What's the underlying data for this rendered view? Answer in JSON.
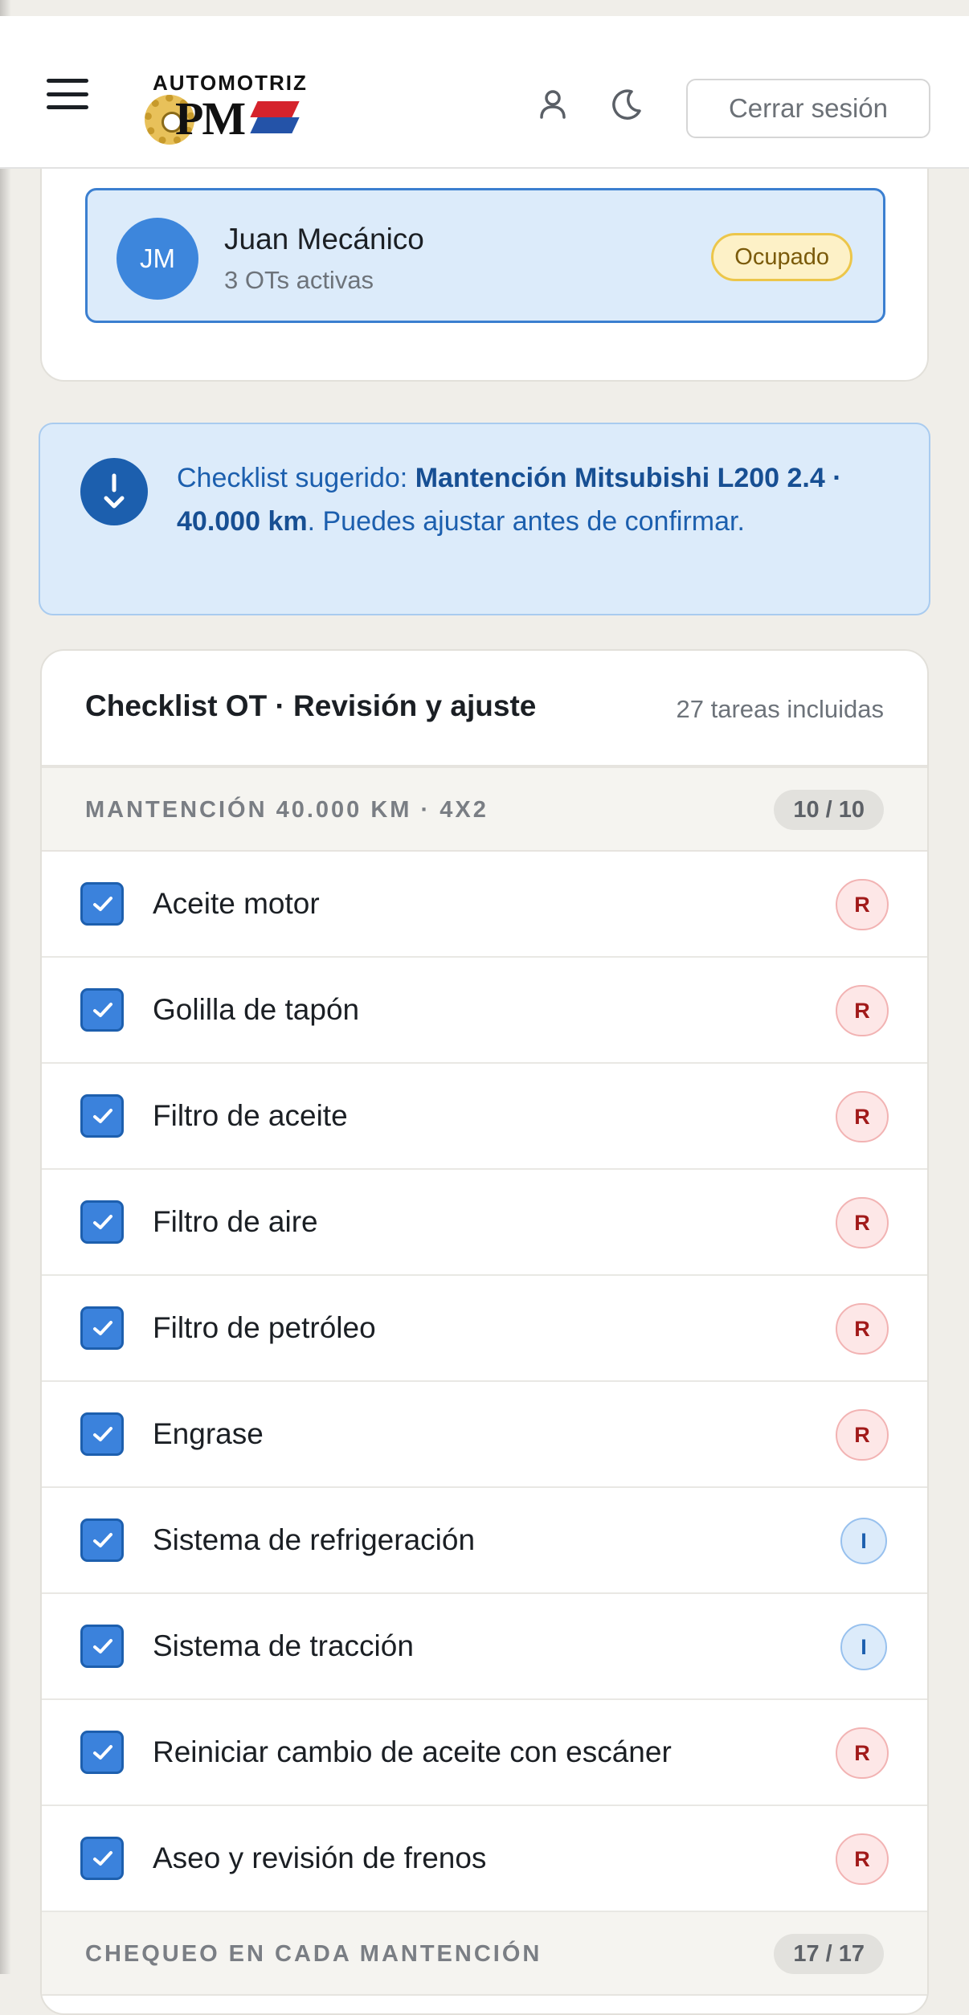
{
  "header": {
    "logo_text": "AUTOMOTRIZ",
    "logo_mark": "PM",
    "logout_label": "Cerrar sesión",
    "icons": [
      "menu-icon",
      "user-icon",
      "moon-icon"
    ]
  },
  "mechanic": {
    "initials": "JM",
    "name": "Juan Mecánico",
    "subtitle": "3 OTs activas",
    "status": "Ocupado"
  },
  "suggestion": {
    "prefix": "Checklist sugerido: ",
    "highlight": "Mantención Mitsubishi L200 2.4 · 40.000 km",
    "suffix": ". Puedes ajustar antes de confirmar."
  },
  "checklist": {
    "title": "Checklist OT · Revisión y ajuste",
    "count": "27 tareas incluidas",
    "sections": [
      {
        "title": "MANTENCIÓN 40.000 KM · 4X2",
        "progress": "10 / 10",
        "items": [
          {
            "label": "Aceite motor",
            "tag": "R",
            "checked": true
          },
          {
            "label": "Golilla de tapón",
            "tag": "R",
            "checked": true
          },
          {
            "label": "Filtro de aceite",
            "tag": "R",
            "checked": true
          },
          {
            "label": "Filtro de aire",
            "tag": "R",
            "checked": true
          },
          {
            "label": "Filtro de petróleo",
            "tag": "R",
            "checked": true
          },
          {
            "label": "Engrase",
            "tag": "R",
            "checked": true
          },
          {
            "label": "Sistema de refrigeración",
            "tag": "I",
            "checked": true
          },
          {
            "label": "Sistema de tracción",
            "tag": "I",
            "checked": true
          },
          {
            "label": "Reiniciar cambio de aceite con escáner",
            "tag": "R",
            "checked": true
          },
          {
            "label": "Aseo y revisión de frenos",
            "tag": "R",
            "checked": true
          }
        ]
      },
      {
        "title": "CHEQUEO EN CADA MANTENCIÓN",
        "progress": "17 / 17",
        "items": []
      }
    ]
  },
  "colors": {
    "accent": "#3b82dc",
    "info_bg": "#dcebfa",
    "busy_bg": "#fdf1c7",
    "tag_r": "#a11a1a",
    "tag_i": "#1c5fae"
  }
}
